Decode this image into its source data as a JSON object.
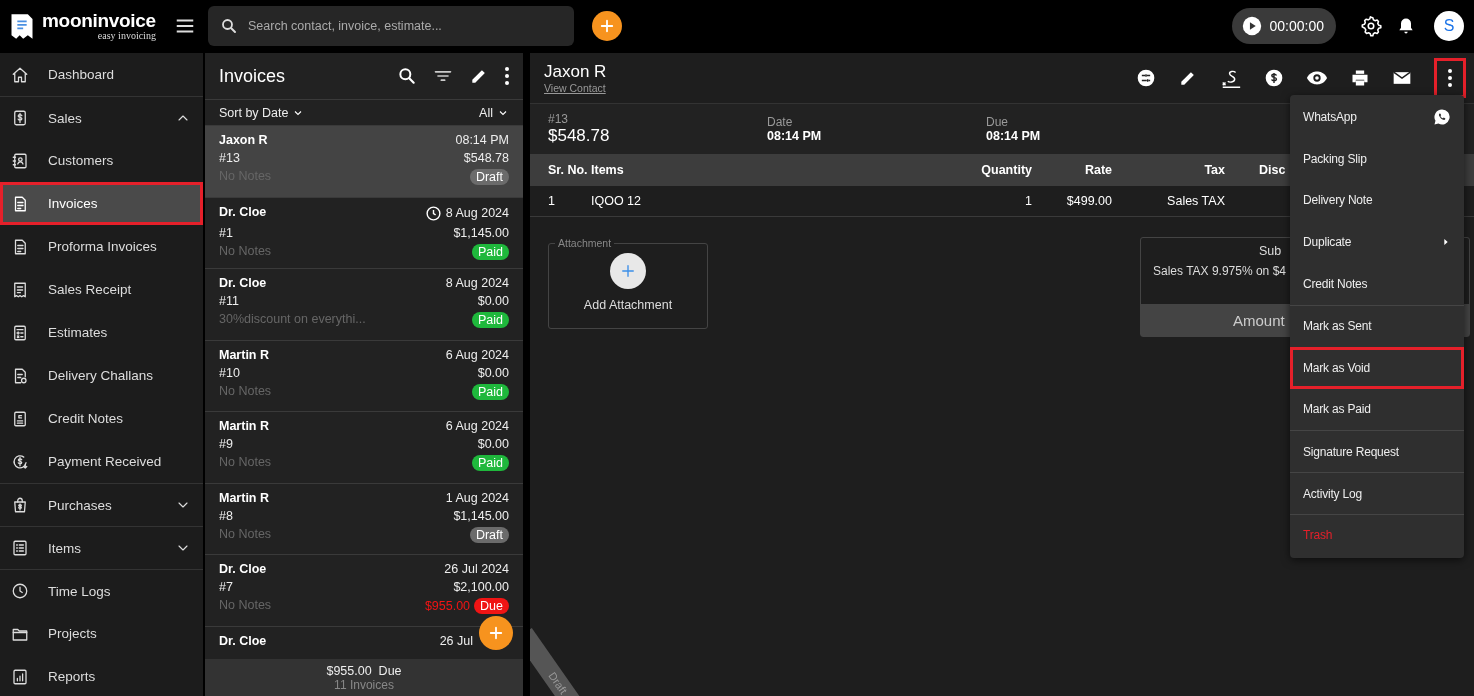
{
  "topbar": {
    "logo_name": "mooninvoice",
    "logo_tagline": "easy invoicing",
    "search": {
      "placeholder": "Search contact, invoice, estimate..."
    },
    "timer": "00:00:00",
    "avatar": "S"
  },
  "sidebar": {
    "items": [
      {
        "label": "Dashboard",
        "kind": "link",
        "selected": false,
        "highlighted": false
      },
      {
        "label": "Sales",
        "kind": "group",
        "expanded": true,
        "selected": false,
        "highlighted": false,
        "children": [
          {
            "label": "Customers",
            "kind": "link",
            "selected": false,
            "highlighted": false
          },
          {
            "label": "Invoices",
            "kind": "link",
            "selected": true,
            "highlighted": true
          },
          {
            "label": "Proforma Invoices",
            "kind": "link",
            "selected": false,
            "highlighted": false
          },
          {
            "label": "Sales Receipt",
            "kind": "link",
            "selected": false,
            "highlighted": false
          },
          {
            "label": "Estimates",
            "kind": "link",
            "selected": false,
            "highlighted": false
          },
          {
            "label": "Delivery Challans",
            "kind": "link",
            "selected": false,
            "highlighted": false
          },
          {
            "label": "Credit Notes",
            "kind": "link",
            "selected": false,
            "highlighted": false
          },
          {
            "label": "Payment Received",
            "kind": "link",
            "selected": false,
            "highlighted": false
          }
        ]
      },
      {
        "label": "Purchases",
        "kind": "group",
        "expanded": false,
        "selected": false,
        "highlighted": false
      },
      {
        "label": "Items",
        "kind": "group",
        "expanded": false,
        "selected": false,
        "highlighted": false
      },
      {
        "label": "Time Logs",
        "kind": "link",
        "selected": false,
        "highlighted": false
      },
      {
        "label": "Projects",
        "kind": "link",
        "selected": false,
        "highlighted": false
      },
      {
        "label": "Reports",
        "kind": "link",
        "selected": false,
        "highlighted": false
      }
    ]
  },
  "invoice_list": {
    "title": "Invoices",
    "sort": "Sort by Date",
    "filter": "All",
    "rows": [
      {
        "name": "Jaxon R",
        "time": "08:14 PM",
        "number": "#13",
        "amount": "$548.78",
        "note": "No Notes",
        "status": "Draft",
        "color": "#6b6b6b",
        "selected": true,
        "reminder": false
      },
      {
        "name": "Dr. Cloe",
        "time": "8 Aug 2024",
        "number": "#1",
        "amount": "$1,145.00",
        "note": "No Notes",
        "status": "Paid",
        "color": "#1fb83c",
        "selected": false,
        "reminder": true
      },
      {
        "name": "Dr. Cloe",
        "time": "8 Aug 2024",
        "number": "#11",
        "amount": "$0.00",
        "note": "30%discount on everythi...",
        "status": "Paid",
        "color": "#1fb83c",
        "selected": false,
        "reminder": false
      },
      {
        "name": "Martin R",
        "time": "6 Aug 2024",
        "number": "#10",
        "amount": "$0.00",
        "note": "No Notes",
        "status": "Paid",
        "color": "#1fb83c",
        "selected": false,
        "reminder": false
      },
      {
        "name": "Martin R",
        "time": "6 Aug 2024",
        "number": "#9",
        "amount": "$0.00",
        "note": "No Notes",
        "status": "Paid",
        "color": "#1fb83c",
        "selected": false,
        "reminder": false
      },
      {
        "name": "Martin R",
        "time": "1 Aug 2024",
        "number": "#8",
        "amount": "$1,145.00",
        "note": "No Notes",
        "status": "Draft",
        "color": "#6b6b6b",
        "selected": false,
        "reminder": false
      },
      {
        "name": "Dr. Cloe",
        "time": "26 Jul 2024",
        "number": "#7",
        "amount": "$2,100.00",
        "note": "No Notes",
        "due_amount": "$955.00",
        "status": "Due",
        "color": "#f01414",
        "selected": false,
        "reminder": false
      },
      {
        "name": "Dr. Cloe",
        "time": "26 Jul",
        "selected": false,
        "reminder": false
      }
    ],
    "footer": {
      "due": "$955.00",
      "due_label": "Due",
      "count": "11 Invoices"
    }
  },
  "detail": {
    "customer": "Jaxon R",
    "contact_link": "View Contact",
    "more_highlighted": true,
    "info": [
      {
        "label": "#13",
        "value": "$548.78",
        "kind": "total"
      },
      {
        "label": "Date",
        "value": "08:14 PM",
        "kind": "field"
      },
      {
        "label": "Due",
        "value": "08:14 PM",
        "kind": "field"
      }
    ],
    "table": {
      "columns": [
        "Sr. No.",
        "Items",
        "Quantity",
        "Rate",
        "Tax",
        "Disc"
      ],
      "rows": [
        [
          "1",
          "IQOO 12",
          "1",
          "$499.00",
          "Sales TAX"
        ]
      ]
    },
    "attachment": {
      "legend": "Attachment",
      "button": "Add Attachment"
    },
    "summary": {
      "subtotal_label": "Sub",
      "tax_line": "Sales TAX 9.975% on $4",
      "amount_label": "Amount"
    },
    "ribbon": "Draft"
  },
  "menu": {
    "items": [
      {
        "label": "WhatsApp",
        "kind": "share",
        "divider_before": false,
        "highlighted": false
      },
      {
        "label": "Packing Slip",
        "kind": "plain",
        "divider_before": false,
        "highlighted": false
      },
      {
        "label": "Delivery Note",
        "kind": "plain",
        "divider_before": false,
        "highlighted": false
      },
      {
        "label": "Duplicate",
        "kind": "submenu",
        "divider_before": false,
        "highlighted": false
      },
      {
        "label": "Credit Notes",
        "kind": "plain",
        "divider_before": false,
        "highlighted": false
      },
      {
        "label": "Mark as Sent",
        "kind": "plain",
        "divider_before": true,
        "highlighted": false
      },
      {
        "label": "Mark as Void",
        "kind": "plain",
        "divider_before": false,
        "highlighted": true
      },
      {
        "label": "Mark as Paid",
        "kind": "plain",
        "divider_before": false,
        "highlighted": false
      },
      {
        "label": "Signature Request",
        "kind": "plain",
        "divider_before": true,
        "highlighted": false
      },
      {
        "label": "Activity Log",
        "kind": "plain",
        "divider_before": true,
        "highlighted": false
      },
      {
        "label": "Trash",
        "kind": "danger",
        "divider_before": true,
        "highlighted": false
      }
    ]
  }
}
